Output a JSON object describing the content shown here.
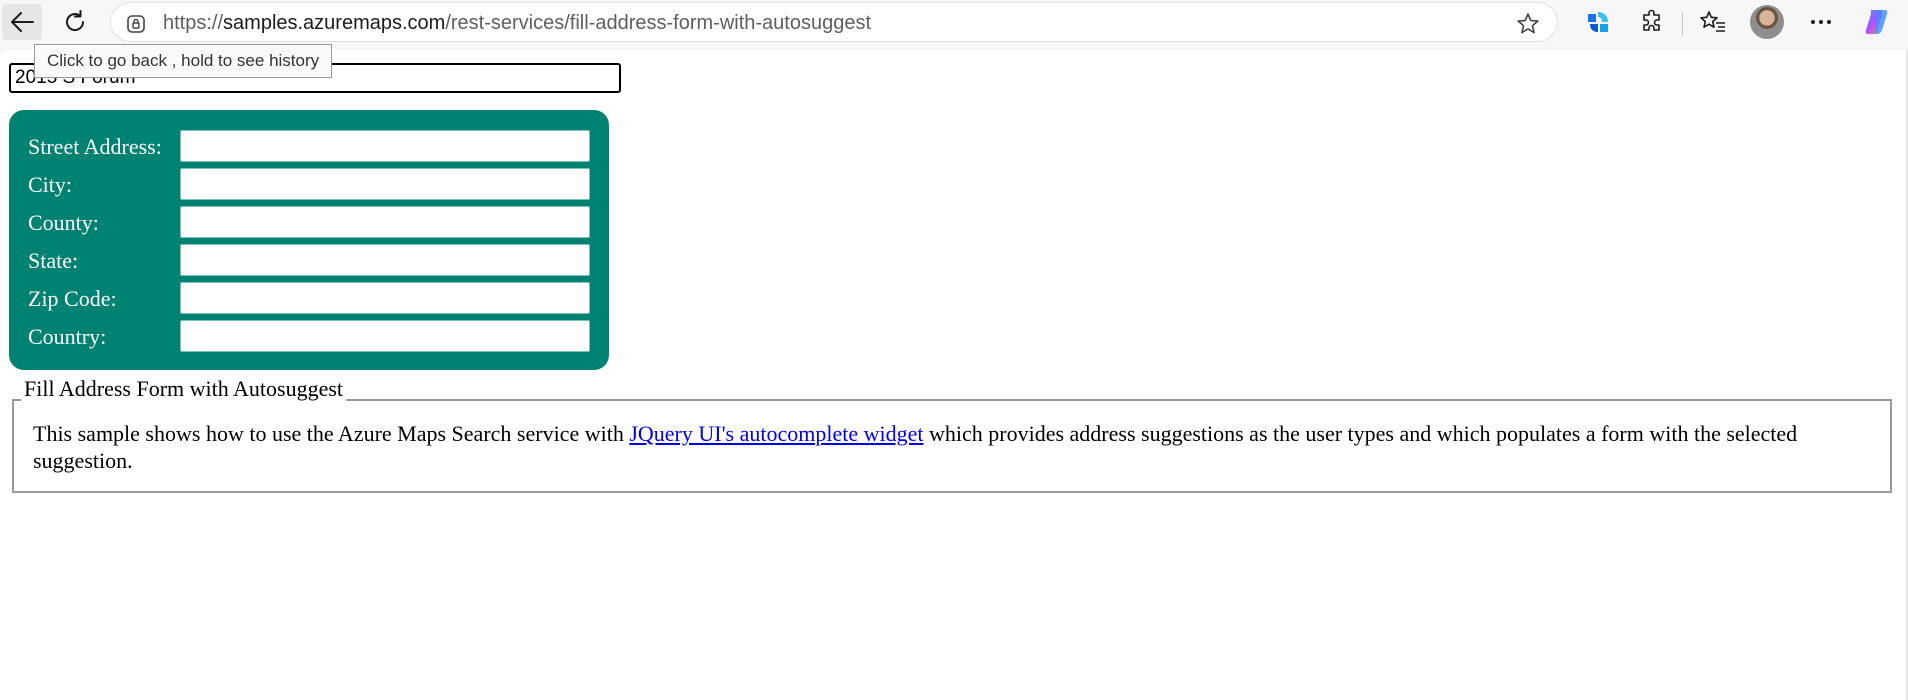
{
  "browser": {
    "url_prefix": "https://",
    "url_host": "samples.azuremaps.com",
    "url_path": "/rest-services/fill-address-form-with-autosuggest",
    "tooltip": "Click to go back , hold to see history"
  },
  "search": {
    "value": "2015 S Forum"
  },
  "form": {
    "fields": [
      {
        "label": "Street Address:",
        "value": ""
      },
      {
        "label": "City:",
        "value": ""
      },
      {
        "label": "County:",
        "value": ""
      },
      {
        "label": "State:",
        "value": ""
      },
      {
        "label": "Zip Code:",
        "value": ""
      },
      {
        "label": "Country:",
        "value": ""
      }
    ]
  },
  "info": {
    "legend": "Fill Address Form with Autosuggest",
    "text_before": "This sample shows how to use the Azure Maps Search service with ",
    "link_text": "JQuery UI's autocomplete widget",
    "text_after": " which provides address suggestions as the user types and which populates a form with the selected suggestion."
  },
  "colors": {
    "panel": "#008272",
    "link": "#0000ee"
  },
  "icons": [
    "back-arrow-icon",
    "reload-icon",
    "site-info-icon",
    "favorite-star-icon",
    "copilot-app-icon",
    "extensions-icon",
    "favorites-icon",
    "profile-avatar",
    "more-options-icon",
    "copilot-icon"
  ]
}
